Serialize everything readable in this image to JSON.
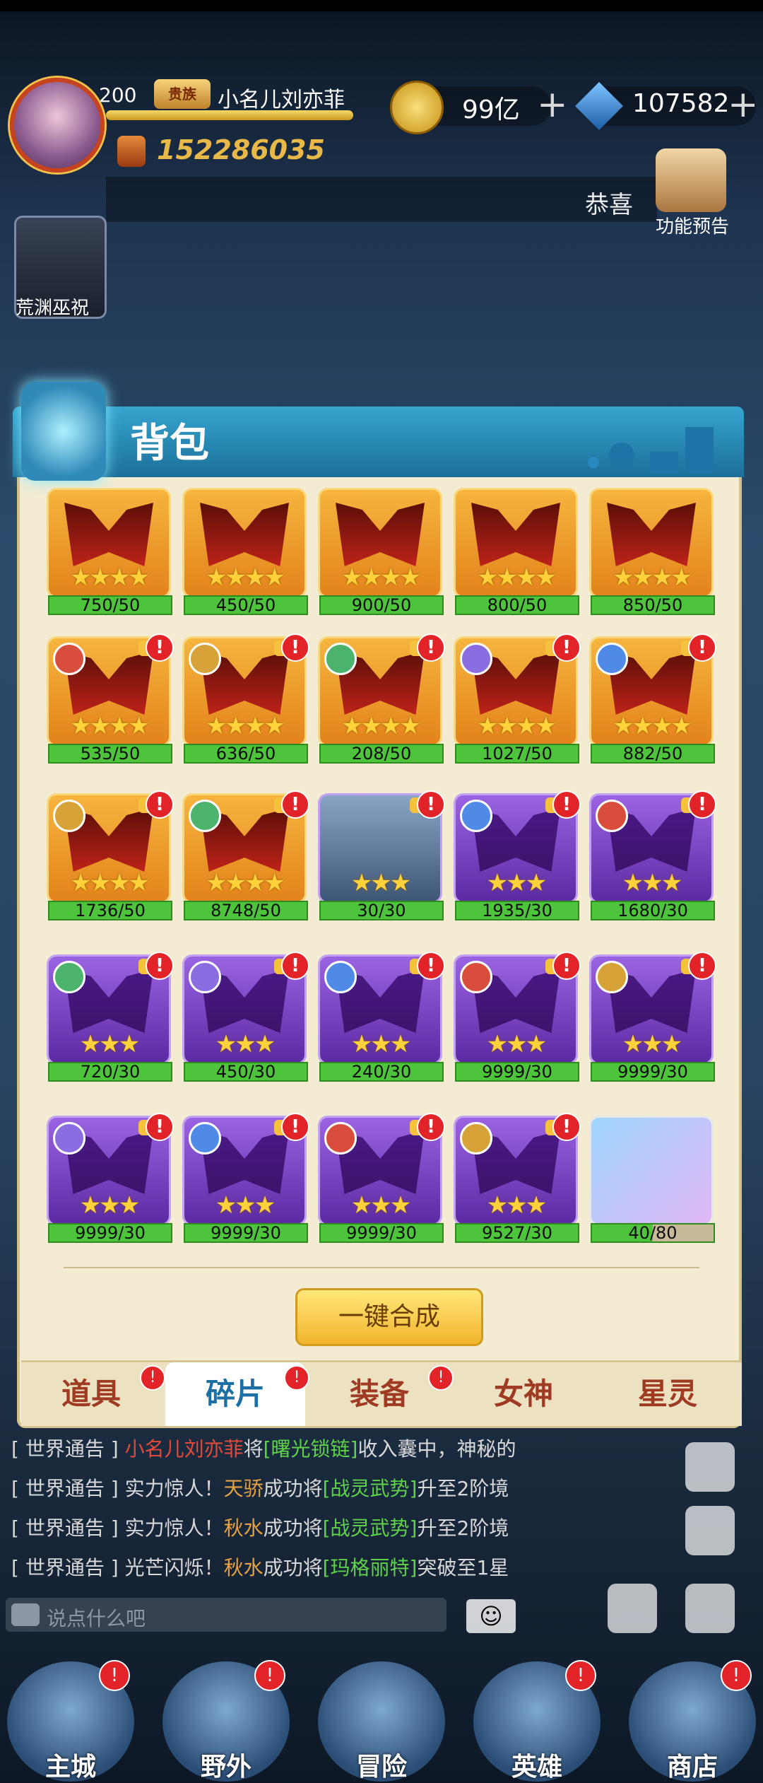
{
  "player": {
    "level": "200",
    "vip_label": "贵族",
    "name": "小名儿刘亦菲",
    "power": "152286035"
  },
  "currency": {
    "gold": "99亿",
    "gems": "107582"
  },
  "ticker": {
    "text": "恭喜"
  },
  "preview": {
    "label": "功能预告"
  },
  "side": {
    "hero_label": "荒渊巫祝"
  },
  "panel": {
    "title": "背包",
    "compose_button": "一键合成",
    "tabs": [
      "道具",
      "碎片",
      "装备",
      "女神",
      "星灵"
    ],
    "active_tab": 1,
    "tab_badges": [
      "!",
      "!",
      "!"
    ]
  },
  "grid": {
    "rows": [
      [
        {
          "count": "750/50",
          "type": "gold",
          "stars": "★★★★",
          "badge": false
        },
        {
          "count": "450/50",
          "type": "gold",
          "stars": "★★★★",
          "badge": false
        },
        {
          "count": "900/50",
          "type": "gold",
          "stars": "★★★★",
          "badge": false
        },
        {
          "count": "800/50",
          "type": "gold",
          "stars": "★★★★",
          "badge": false
        },
        {
          "count": "850/50",
          "type": "gold",
          "stars": "★★★★",
          "badge": false
        }
      ],
      [
        {
          "count": "535/50",
          "type": "gold",
          "stars": "★★★★",
          "badge": true
        },
        {
          "count": "636/50",
          "type": "gold",
          "stars": "★★★★",
          "badge": true
        },
        {
          "count": "208/50",
          "type": "gold",
          "stars": "★★★★",
          "badge": true
        },
        {
          "count": "1027/50",
          "type": "gold",
          "stars": "★★★★",
          "badge": true
        },
        {
          "count": "882/50",
          "type": "gold",
          "stars": "★★★★",
          "badge": true
        }
      ],
      [
        {
          "count": "1736/50",
          "type": "gold",
          "stars": "★★★★",
          "badge": true
        },
        {
          "count": "8748/50",
          "type": "gold",
          "stars": "★★★★",
          "badge": true
        },
        {
          "count": "30/30",
          "type": "portrait",
          "stars": "★★★",
          "badge": true
        },
        {
          "count": "1935/30",
          "type": "purple",
          "stars": "★★★",
          "badge": true
        },
        {
          "count": "1680/30",
          "type": "purple",
          "stars": "★★★",
          "badge": true
        }
      ],
      [
        {
          "count": "720/30",
          "type": "purple",
          "stars": "★★★",
          "badge": true
        },
        {
          "count": "450/30",
          "type": "purple",
          "stars": "★★★",
          "badge": true
        },
        {
          "count": "240/30",
          "type": "purple",
          "stars": "★★★",
          "badge": true
        },
        {
          "count": "9999/30",
          "type": "purple",
          "stars": "★★★",
          "badge": true
        },
        {
          "count": "9999/30",
          "type": "purple",
          "stars": "★★★",
          "badge": true
        }
      ],
      [
        {
          "count": "9999/30",
          "type": "purple",
          "stars": "★★★",
          "badge": true
        },
        {
          "count": "9999/30",
          "type": "purple",
          "stars": "★★★",
          "badge": true
        },
        {
          "count": "9999/30",
          "type": "purple",
          "stars": "★★★",
          "badge": true
        },
        {
          "count": "9527/30",
          "type": "purple",
          "stars": "★★★",
          "badge": true
        },
        {
          "count": "40/80",
          "type": "item",
          "stars": "",
          "badge": false,
          "progress": 0.5
        }
      ]
    ]
  },
  "chat": [
    {
      "prefix": "[ 世界通告 ]",
      "name": "小名儿刘亦菲",
      "mid": "将",
      "link": "[曙光锁链]",
      "tail": "收入囊中，神秘的"
    },
    {
      "prefix": "[ 世界通告 ]",
      "lead": "实力惊人！",
      "name": "天骄",
      "mid": "成功将",
      "link": "[战灵武势]",
      "tail": "升至2阶境"
    },
    {
      "prefix": "[ 世界通告 ]",
      "lead": "实力惊人！",
      "name": "秋水",
      "mid": "成功将",
      "link": "[战灵武势]",
      "tail": "升至2阶境"
    },
    {
      "prefix": "[ 世界通告 ]",
      "lead": "光芒闪烁！",
      "name": "秋水",
      "mid": "成功将",
      "link": "[玛格丽特]",
      "tail": "突破至1星"
    }
  ],
  "chat_input": {
    "placeholder": "说点什么吧"
  },
  "nav": [
    "主城",
    "野外",
    "冒险",
    "英雄",
    "商店"
  ],
  "colors": {
    "accent_blue": "#1b6fa3",
    "badge_red": "#e22328",
    "bar_green": "#4dc43b"
  }
}
